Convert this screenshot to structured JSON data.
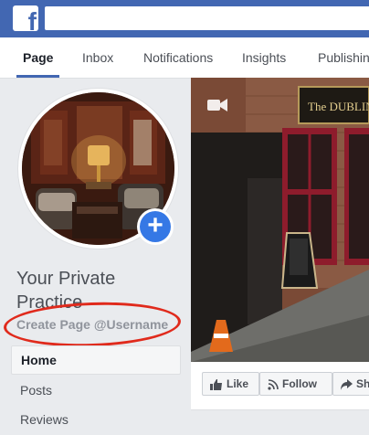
{
  "topbar": {
    "logo_letter": "f",
    "search_placeholder": ""
  },
  "nav": {
    "tabs": [
      {
        "label": "Page",
        "active": true
      },
      {
        "label": "Inbox"
      },
      {
        "label": "Notifications"
      },
      {
        "label": "Insights"
      },
      {
        "label": "Publishing"
      }
    ]
  },
  "profile": {
    "name": "Your Private Practice",
    "username_link": "Create Page @Username",
    "add_photo_symbol": "+"
  },
  "side_menu": {
    "items": [
      {
        "label": "Home",
        "active": true
      },
      {
        "label": "Posts"
      },
      {
        "label": "Reviews"
      }
    ]
  },
  "cover": {
    "sign_text": "The DUBLINE"
  },
  "actions": {
    "like": "Like",
    "follow": "Follow",
    "share": "Sh"
  },
  "colors": {
    "brand": "#4267b2",
    "annotation": "#e02a1c",
    "add_photo": "#3578e5"
  }
}
